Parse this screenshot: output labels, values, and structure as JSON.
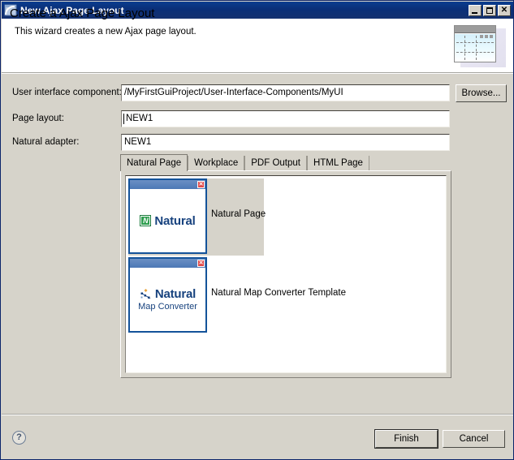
{
  "window": {
    "title": "New Ajax Page Layout",
    "icon": "page-layout-icon",
    "controls": {
      "minimize": "minimize-icon",
      "maximize": "maximize-icon",
      "close": "close-icon"
    }
  },
  "header": {
    "title": "Create a Ajax Page Layout",
    "subtitle": "This wizard creates a new Ajax page layout.",
    "banner_icon": "page-layout-banner-icon"
  },
  "fields": [
    {
      "label": "User interface component:",
      "value": "/MyFirstGuiProject/User-Interface-Components/MyUI",
      "name": "user-interface-component",
      "caret": false
    },
    {
      "label": "Page layout:",
      "value": "NEW1",
      "name": "page-layout",
      "caret": true
    },
    {
      "label": "Natural adapter:",
      "value": "NEW1",
      "name": "natural-adapter",
      "caret": false
    }
  ],
  "browse": {
    "label": "Browse..."
  },
  "tabs": [
    {
      "label": "Natural Page",
      "selected": true
    },
    {
      "label": "Workplace",
      "selected": false
    },
    {
      "label": "PDF Output",
      "selected": false
    },
    {
      "label": "HTML Page",
      "selected": false
    }
  ],
  "templates": [
    {
      "label": "Natural Page",
      "logo_word": "Natural",
      "logo_sub": "",
      "logo_mark": "N",
      "icon": "natural-logo-icon",
      "selected": true
    },
    {
      "label": "Natural Map Converter Template",
      "logo_word": "Natural",
      "logo_sub": "Map Converter",
      "logo_mark": "",
      "icon": "natural-map-converter-logo-icon",
      "selected": false
    }
  ],
  "footer": {
    "help": "?",
    "finish_label": "Finish",
    "cancel_label": "Cancel"
  },
  "colors": {
    "titlebar": "#0a2f78",
    "dialog_bg": "#d6d3ca",
    "accent_blue": "#17427e",
    "logo_green": "#2f9e4f",
    "close_red": "#e04a4a"
  }
}
